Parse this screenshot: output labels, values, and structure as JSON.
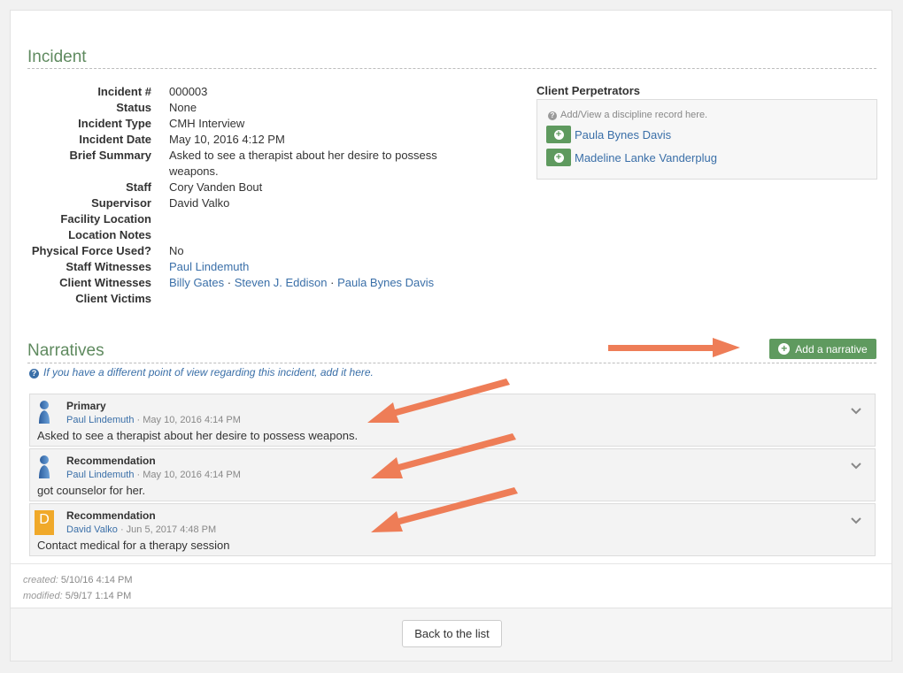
{
  "incident": {
    "section_title": "Incident",
    "fields": [
      {
        "label": "Incident #",
        "value": "000003"
      },
      {
        "label": "Status",
        "value": "None"
      },
      {
        "label": "Incident Type",
        "value": "CMH Interview"
      },
      {
        "label": "Incident Date",
        "value": "May 10, 2016 4:12 PM"
      },
      {
        "label": "Brief Summary",
        "value": "Asked to see a therapist about her desire to possess weapons."
      },
      {
        "label": "Staff",
        "value": "Cory Vanden Bout"
      },
      {
        "label": "Supervisor",
        "value": "David Valko"
      },
      {
        "label": "Facility Location",
        "value": ""
      },
      {
        "label": "Location Notes",
        "value": ""
      },
      {
        "label": "Physical Force Used?",
        "value": "No"
      },
      {
        "label": "Staff Witnesses",
        "value": "Paul Lindemuth"
      },
      {
        "label": "Client Witnesses",
        "links": [
          "Billy Gates",
          "Steven J. Eddison",
          "Paula Bynes Davis"
        ],
        "separator": " · "
      },
      {
        "label": "Client Victims",
        "value": ""
      }
    ]
  },
  "client_perpetrators": {
    "title": "Client Perpetrators",
    "hint": "Add/View a discipline record here.",
    "items": [
      "Paula Bynes Davis",
      "Madeline Lanke Vanderplug"
    ]
  },
  "narratives": {
    "section_title": "Narratives",
    "add_button_label": "Add a narrative",
    "hint": "If you have a different point of view regarding this incident, add it here.",
    "items": [
      {
        "title": "Primary",
        "author": "Paul Lindemuth",
        "date": "May 10, 2016 4:14 PM",
        "text": "Asked to see a therapist about her desire to possess weapons.",
        "avatar": "person-icon"
      },
      {
        "title": "Recommendation",
        "author": "Paul Lindemuth",
        "date": "May 10, 2016 4:14 PM",
        "text": "got counselor for her.",
        "avatar": "person-icon"
      },
      {
        "title": "Recommendation",
        "author": "David Valko",
        "date": "Jun 5, 2017 4:48 PM",
        "text": "Contact medical for a therapy session",
        "avatar": "letter-avatar",
        "avatar_letter": "D"
      }
    ]
  },
  "stamps": {
    "created_label": "created:",
    "created_value": "5/10/16 4:14 PM",
    "modified_label": "modified:",
    "modified_value": "5/9/17 1:14 PM"
  },
  "footer": {
    "back_label": "Back to the list"
  },
  "colors": {
    "accent_green": "#5f9a5f",
    "title_green": "#5f8a5f",
    "link_blue": "#3a6fa8",
    "annotation_arrow": "#ee7d57",
    "avatar_orange": "#f0a92a"
  }
}
